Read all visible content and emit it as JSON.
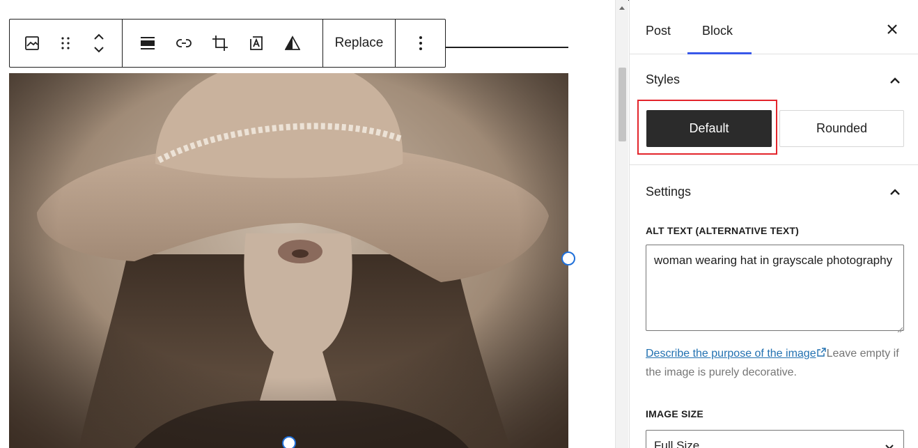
{
  "toolbar": {
    "icons": [
      "image-icon",
      "drag-handle-icon",
      "move-up-down-icon",
      "align-icon",
      "link-icon",
      "crop-icon",
      "text-overlay-icon",
      "duotone-icon",
      "more-options-icon"
    ],
    "replace_label": "Replace"
  },
  "image": {
    "description_icon": "photo-woman-hat"
  },
  "sidebar": {
    "tabs": [
      {
        "label": "Post",
        "active": false
      },
      {
        "label": "Block",
        "active": true
      }
    ],
    "styles": {
      "heading": "Styles",
      "options": [
        {
          "label": "Default",
          "selected": true
        },
        {
          "label": "Rounded",
          "selected": false
        }
      ]
    },
    "settings": {
      "heading": "Settings",
      "alt_label": "ALT TEXT (ALTERNATIVE TEXT)",
      "alt_value": "woman wearing hat in grayscale photography",
      "help_link": "Describe the purpose of the image",
      "help_rest": "Leave empty if the image is purely decorative.",
      "image_size_label": "IMAGE SIZE",
      "image_size_value": "Full Size"
    }
  },
  "colors": {
    "accent": "#3858e9",
    "highlight": "#e3242b",
    "link": "#2271b1",
    "handle": "#1e6fd9"
  }
}
